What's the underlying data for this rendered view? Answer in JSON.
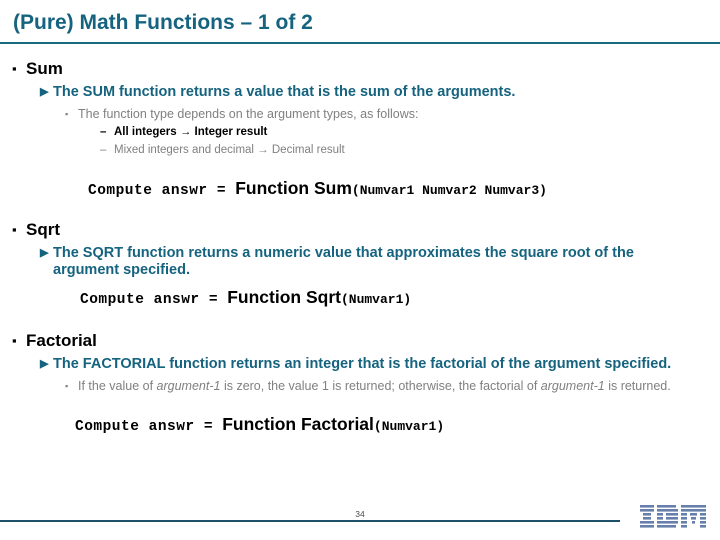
{
  "slide": {
    "title": "(Pure) Math Functions – 1 of 2",
    "page_number": "34",
    "accent_color": "#15637f",
    "rule_color": "#176a80",
    "logo_name": "IBM"
  },
  "sections": [
    {
      "heading": "Sum",
      "bullet_glyph": "▪",
      "description": "The SUM function returns a value that is the sum of the arguments.",
      "description_glyph": "▶",
      "sub_note": "The function type depends on the argument types, as follows:",
      "sub_note_glyph": "▪",
      "dash_items": [
        {
          "text": "All integers → Integer result",
          "emphasis": "bold"
        },
        {
          "text": "Mixed integers and decimal → Decimal result",
          "emphasis": "normal"
        }
      ],
      "code": {
        "prefix": "Compute answr = ",
        "keyword": "Function Sum",
        "args": "(Numvar1 Numvar2 Numvar3)"
      }
    },
    {
      "heading": "Sqrt",
      "bullet_glyph": "▪",
      "description": "The SQRT function returns a numeric value that approximates the square root of the argument specified.",
      "description_glyph": "▶",
      "code": {
        "prefix": "Compute answr = ",
        "keyword": "Function Sqrt",
        "args": "(Numvar1)"
      }
    },
    {
      "heading": "Factorial",
      "bullet_glyph": "▪",
      "description": "The FACTORIAL function returns an integer that is the factorial of the argument specified.",
      "description_glyph": "▶",
      "sub_note_parts": {
        "lead": "If the value of ",
        "italic_1": "argument-1",
        "middle": " is zero, the value 1 is returned; otherwise, the factorial of ",
        "italic_2": "argument-1",
        "tail": " is returned."
      },
      "sub_note_glyph": "▪",
      "code": {
        "prefix": "Compute answr = ",
        "keyword": "Function Factorial",
        "args": "(Numvar1)"
      }
    }
  ]
}
